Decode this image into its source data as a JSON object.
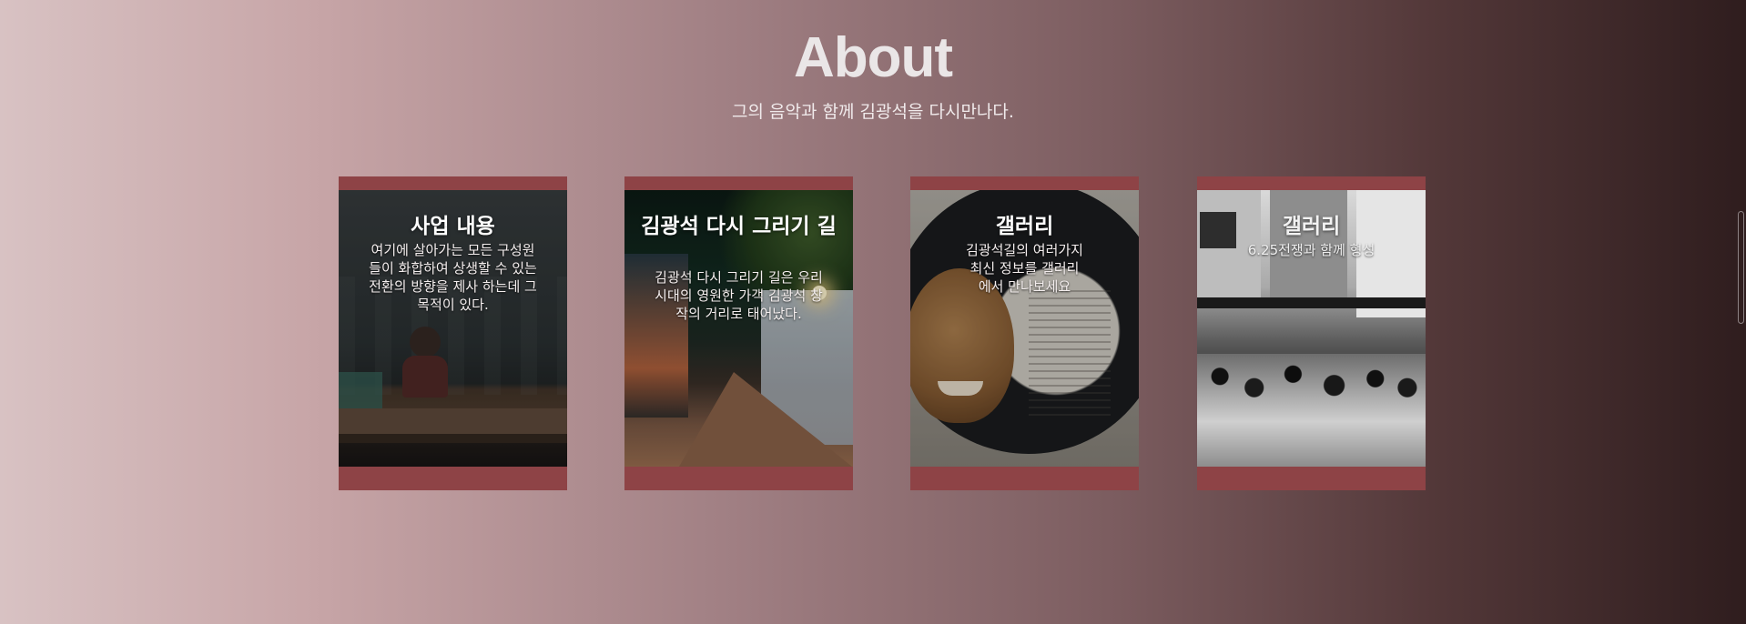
{
  "section": {
    "title": "About",
    "subtitle": "그의 음악과 함께 김광석을 다시만나다."
  },
  "cards": [
    {
      "title": "사업 내용",
      "description": "여기에 살아가는 모든 구성원들이 화합하여 상생할 수 있는 전환의 방향을 제사 하는데 그 목적이 있다."
    },
    {
      "title": "김광석 다시 그리기 길",
      "description": "김광석 다시 그리기 길은 우리시대의 영원한 가객 김광석 창작의 거리로 태어났다."
    },
    {
      "title": "갤러리",
      "description": "김광석길의 여러가지 최신 정보를 갤러리에서 만나보세요"
    },
    {
      "title": "갤러리",
      "description": "6.25전쟁과 함께 형성"
    }
  ],
  "colors": {
    "card_frame": "#8e4346",
    "title_text": "#eae6e7"
  },
  "icons": {
    "scroll": "scroll-indicator-icon"
  }
}
